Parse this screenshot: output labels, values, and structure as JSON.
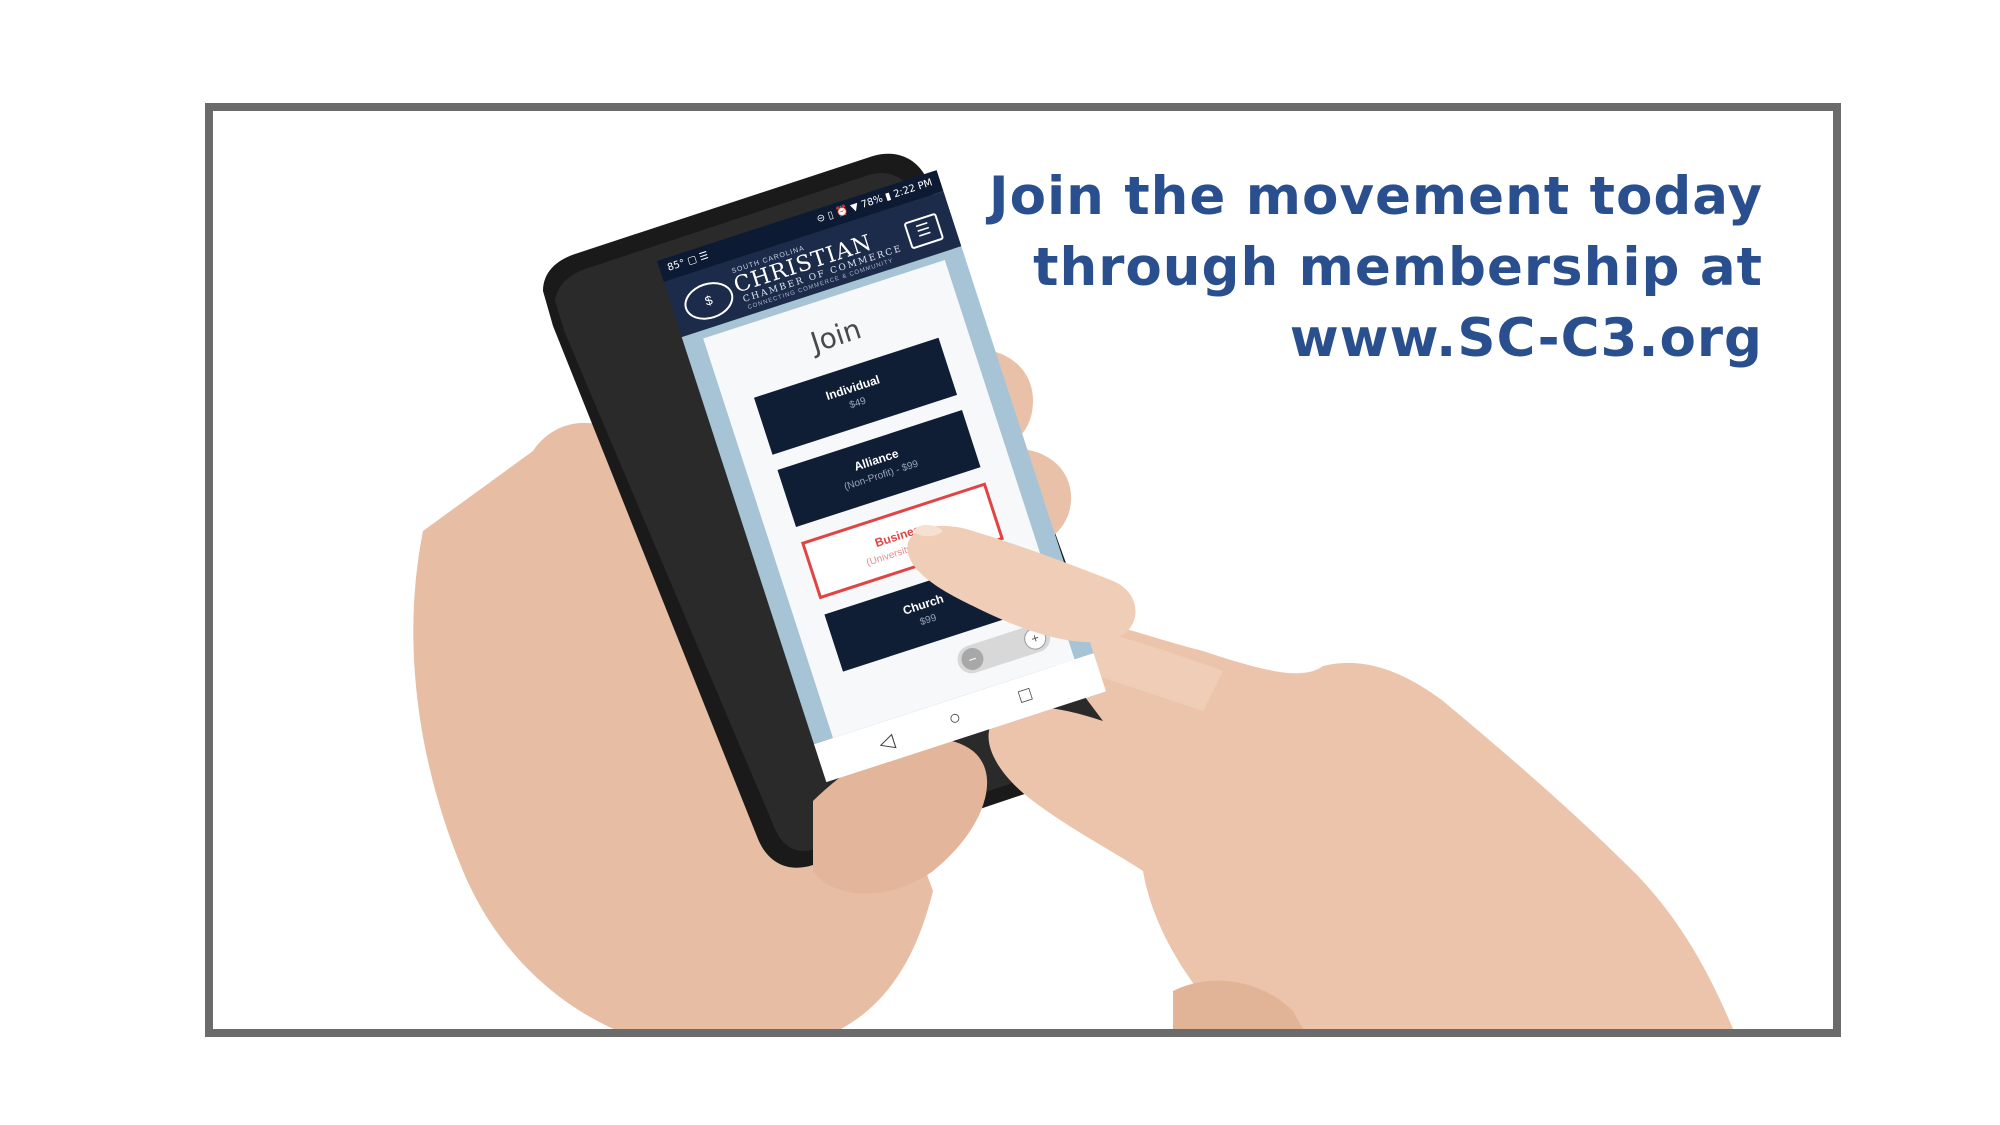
{
  "headline": {
    "line1": "Join the movement today",
    "line2": "through membership at",
    "line3": "www.SC-C3.org"
  },
  "phone": {
    "status_left": "85° ▢ ☰",
    "status_right": "⊝ ▯ ⏰ ▼ 78% ▮ 2:22 PM",
    "brand_top": "SOUTH CAROLINA",
    "brand": "CHRISTIAN",
    "brand_sub": "CHAMBER OF COMMERCE",
    "brand_tag": "CONNECTING COMMERCE & COMMUNITY",
    "menu_icon": "☰",
    "join_title": "Join",
    "tiers": [
      {
        "name": "Individual",
        "price": "$49"
      },
      {
        "name": "Alliance",
        "price": "(Non-Profit) - $99"
      },
      {
        "name": "Business",
        "price": "(University) - $299"
      },
      {
        "name": "Church",
        "price": "$99"
      }
    ],
    "selected_tier_index": 2,
    "nav": {
      "back": "◁",
      "home": "○",
      "recents": "□"
    },
    "zoom_out": "−",
    "zoom_in": "+"
  },
  "colors": {
    "headline": "#2a4f8e",
    "frame": "#6b6b6b",
    "navy": "#1b2b49",
    "selected": "#e04545"
  }
}
